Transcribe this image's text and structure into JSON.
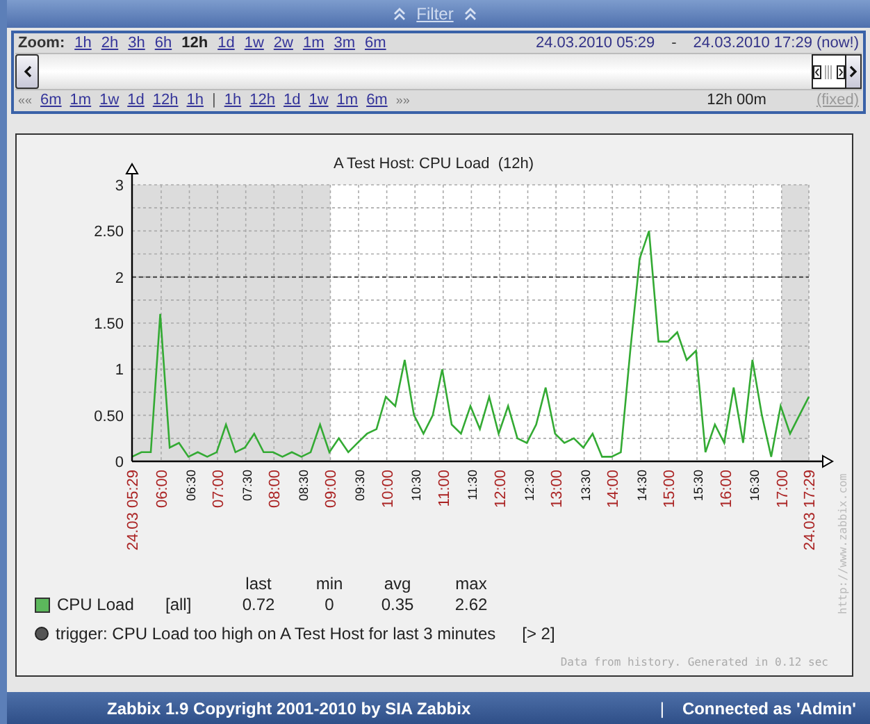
{
  "filter": {
    "label": "Filter"
  },
  "zoom": {
    "label": "Zoom:",
    "options": [
      {
        "label": "1h",
        "selected": false
      },
      {
        "label": "2h",
        "selected": false
      },
      {
        "label": "3h",
        "selected": false
      },
      {
        "label": "6h",
        "selected": false
      },
      {
        "label": "12h",
        "selected": true
      },
      {
        "label": "1d",
        "selected": false
      },
      {
        "label": "1w",
        "selected": false
      },
      {
        "label": "2w",
        "selected": false
      },
      {
        "label": "1m",
        "selected": false
      },
      {
        "label": "3m",
        "selected": false
      },
      {
        "label": "6m",
        "selected": false
      }
    ],
    "from": "24.03.2010 05:29",
    "separator": "-",
    "to": "24.03.2010 17:29",
    "now": "(now!)"
  },
  "navigation": {
    "back_marker": "««",
    "back": [
      "6m",
      "1m",
      "1w",
      "1d",
      "12h",
      "1h"
    ],
    "separator": "|",
    "forward": [
      "1h",
      "12h",
      "1d",
      "1w",
      "1m",
      "6m"
    ],
    "forward_marker": "»»",
    "period": "12h 00m",
    "fixed": "(fixed)"
  },
  "graph": {
    "chart_data": {
      "type": "line",
      "title": "A Test Host: CPU Load  (12h)",
      "xlim": [
        329,
        1049
      ],
      "ylim": [
        0,
        3
      ],
      "yticks": [
        0,
        {
          "value": 0.5,
          "label": "0.50"
        },
        1,
        {
          "value": 1.5,
          "label": "1.50"
        },
        2,
        {
          "value": 2.5,
          "label": "2.50"
        },
        3
      ],
      "xticks": [
        {
          "value": 329,
          "label": "24.03 05:29"
        },
        {
          "value": 360,
          "label": "06:00"
        },
        {
          "value": 390,
          "label": "06:30"
        },
        {
          "value": 420,
          "label": "07:00"
        },
        {
          "value": 450,
          "label": "07:30"
        },
        {
          "value": 480,
          "label": "08:00"
        },
        {
          "value": 510,
          "label": "08:30"
        },
        {
          "value": 540,
          "label": "09:00"
        },
        {
          "value": 570,
          "label": "09:30"
        },
        {
          "value": 600,
          "label": "10:00"
        },
        {
          "value": 630,
          "label": "10:30"
        },
        {
          "value": 660,
          "label": "11:00"
        },
        {
          "value": 690,
          "label": "11:30"
        },
        {
          "value": 720,
          "label": "12:00"
        },
        {
          "value": 750,
          "label": "12:30"
        },
        {
          "value": 780,
          "label": "13:00"
        },
        {
          "value": 810,
          "label": "13:30"
        },
        {
          "value": 840,
          "label": "14:00"
        },
        {
          "value": 870,
          "label": "14:30"
        },
        {
          "value": 900,
          "label": "15:00"
        },
        {
          "value": 930,
          "label": "15:30"
        },
        {
          "value": 960,
          "label": "16:00"
        },
        {
          "value": 990,
          "label": "16:30"
        },
        {
          "value": 1020,
          "label": "17:00"
        },
        {
          "value": 1049,
          "label": "24.03 17:29"
        }
      ],
      "x": [
        329,
        339,
        349,
        359,
        369,
        379,
        389,
        399,
        409,
        419,
        429,
        439,
        449,
        459,
        469,
        479,
        489,
        499,
        509,
        519,
        529,
        539,
        549,
        559,
        569,
        579,
        589,
        599,
        609,
        619,
        629,
        639,
        649,
        659,
        669,
        679,
        689,
        699,
        709,
        719,
        729,
        739,
        749,
        759,
        769,
        779,
        789,
        799,
        809,
        819,
        829,
        839,
        849,
        859,
        869,
        879,
        889,
        899,
        909,
        919,
        929,
        939,
        949,
        959,
        969,
        979,
        989,
        999,
        1009,
        1019,
        1029,
        1039,
        1049
      ],
      "series": [
        {
          "name": "CPU Load",
          "color": "#33aa33",
          "values": [
            0.05,
            0.1,
            0.1,
            1.6,
            0.15,
            0.2,
            0.05,
            0.1,
            0.05,
            0.1,
            0.4,
            0.1,
            0.15,
            0.3,
            0.1,
            0.1,
            0.05,
            0.1,
            0.05,
            0.1,
            0.4,
            0.1,
            0.25,
            0.1,
            0.2,
            0.3,
            0.35,
            0.7,
            0.6,
            1.1,
            0.5,
            0.3,
            0.5,
            1.0,
            0.4,
            0.3,
            0.6,
            0.35,
            0.7,
            0.3,
            0.6,
            0.25,
            0.2,
            0.4,
            0.8,
            0.3,
            0.2,
            0.25,
            0.15,
            0.3,
            0.05,
            0.05,
            0.1,
            1.2,
            2.2,
            2.5,
            1.3,
            1.3,
            1.4,
            1.1,
            1.2,
            0.1,
            0.4,
            0.2,
            0.8,
            0.2,
            1.1,
            0.5,
            0.05,
            0.6,
            0.3,
            0.5,
            0.7
          ]
        }
      ],
      "grid": true,
      "bands": [
        {
          "axis": "x",
          "from": 329,
          "to": 540
        },
        {
          "axis": "x",
          "from": 1020,
          "to": 1049
        }
      ],
      "ref_lines": [
        {
          "axis": "y",
          "value": 2
        }
      ]
    },
    "legend": {
      "columns": [
        "last",
        "min",
        "avg",
        "max"
      ],
      "items": [
        {
          "color": "#5cb85c",
          "function": "[all]",
          "values": [
            "0.72",
            "0",
            "0.35",
            "2.62"
          ]
        }
      ],
      "trigger": {
        "text": "trigger: CPU Load too high on A Test Host for last 3 minutes",
        "condition": "[> 2]",
        "color": "#555555"
      }
    },
    "watermark": "http://www.zabbix.com",
    "footnote": "Data from history. Generated in 0.12 sec"
  },
  "footer": {
    "copyright": "Zabbix 1.9 Copyright 2001-2010 by SIA Zabbix",
    "separator": "|",
    "connected": "Connected as 'Admin'"
  }
}
